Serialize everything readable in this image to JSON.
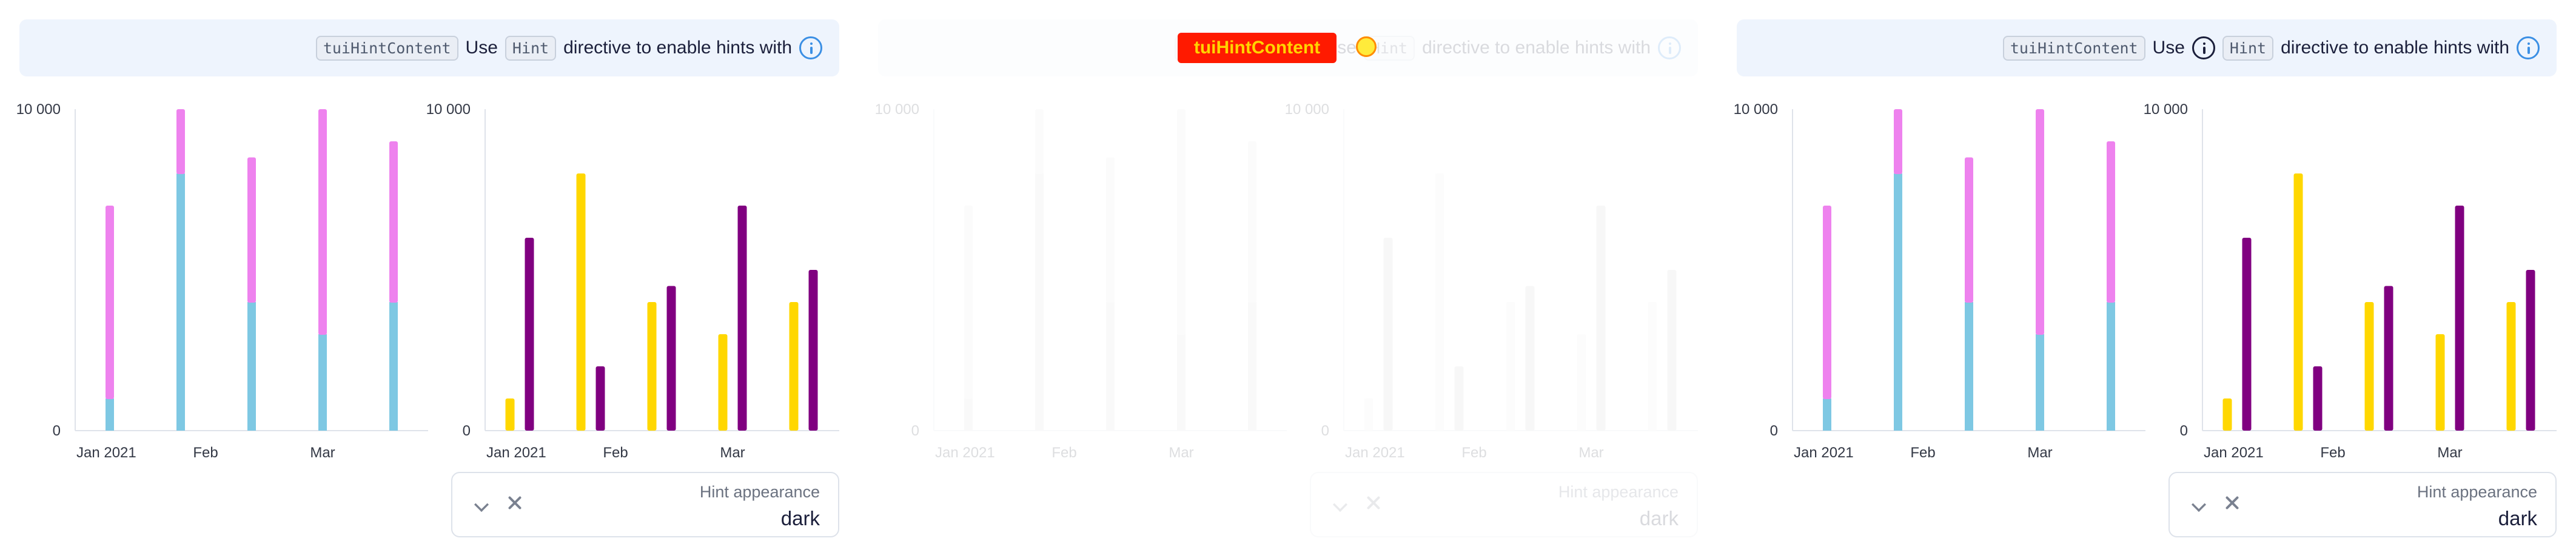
{
  "hint_bar": {
    "code_chip_1": "tuiHintContent",
    "word_use": "Use",
    "code_chip_2": "Hint",
    "text_tail": "directive to enable hints with",
    "icon": "info-icon"
  },
  "control": {
    "label": "Hint appearance",
    "value": "dark",
    "chevron_icon": "chevron-down-icon",
    "clear_icon": "close-icon"
  },
  "overlap_banner": "tuiHintContent",
  "colors": {
    "hint_bg": "#eef4fd",
    "accent_blue": "#3b8fe4",
    "stack_bottom": "#7ec8e3",
    "stack_top": "#ee82ee",
    "series_a": "#ffd700",
    "series_b": "#800080",
    "faded_bar": "#e5e5e5"
  },
  "chart_data": [
    {
      "type": "bar",
      "stacked": true,
      "ylim": [
        0,
        10000
      ],
      "yticks": [
        "0",
        "10 000"
      ],
      "xticks": [
        "Jan 2021",
        "Feb",
        "Mar"
      ],
      "categories": [
        "1",
        "2",
        "3",
        "4",
        "5"
      ],
      "series": [
        {
          "values": [
            1000,
            8000,
            4000,
            3000,
            4000
          ]
        },
        {
          "values": [
            6000,
            2000,
            4500,
            7000,
            5000
          ]
        }
      ]
    },
    {
      "type": "bar",
      "stacked": false,
      "ylim": [
        0,
        10000
      ],
      "yticks": [
        "0",
        "10 000"
      ],
      "xticks": [
        "Jan 2021",
        "Feb",
        "Mar"
      ],
      "categories": [
        "1",
        "2",
        "3",
        "4",
        "5"
      ],
      "series": [
        {
          "values": [
            1000,
            8000,
            4000,
            3000,
            4000
          ]
        },
        {
          "values": [
            6000,
            2000,
            4500,
            7000,
            5000
          ]
        }
      ]
    }
  ]
}
